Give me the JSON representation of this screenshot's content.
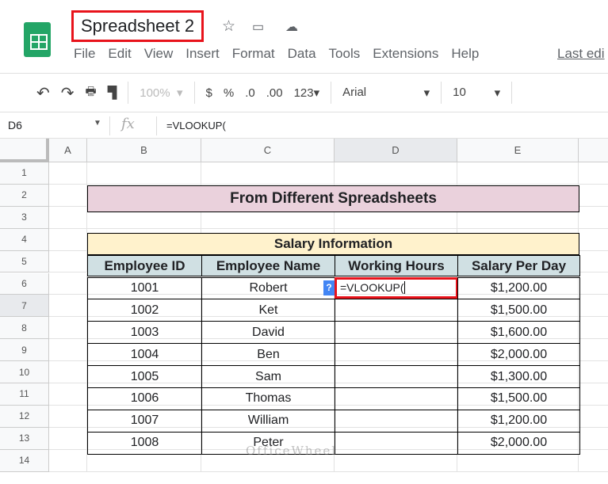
{
  "app": {
    "title": "Spreadsheet 2",
    "menu": [
      "File",
      "Edit",
      "View",
      "Insert",
      "Format",
      "Data",
      "Tools",
      "Extensions",
      "Help"
    ],
    "last_edit": "Last edi"
  },
  "toolbar": {
    "zoom": "100%",
    "currency": "$",
    "percent": "%",
    "dec_decrease": ".0",
    "dec_increase": ".00",
    "more_formats": "123",
    "font": "Arial",
    "font_size": "10"
  },
  "formula_bar": {
    "cell_ref": "D6",
    "fx": "fx",
    "formula": "=VLOOKUP("
  },
  "columns": [
    "A",
    "B",
    "C",
    "D",
    "E"
  ],
  "rows": [
    "1",
    "2",
    "3",
    "4",
    "5",
    "6",
    "7",
    "8",
    "9",
    "10",
    "11",
    "12",
    "13",
    "14"
  ],
  "sheet": {
    "title": "From Different Spreadsheets",
    "table_title": "Salary Information",
    "headers": [
      "Employee ID",
      "Employee Name",
      "Working Hours",
      "Salary Per Day"
    ],
    "data": [
      [
        "1001",
        "Robert",
        "=VLOOKUP(",
        "$1,200.00"
      ],
      [
        "1002",
        "Ket",
        "",
        "$1,500.00"
      ],
      [
        "1003",
        "David",
        "",
        "$1,600.00"
      ],
      [
        "1004",
        "Ben",
        "",
        "$2,000.00"
      ],
      [
        "1005",
        "Sam",
        "",
        "$1,300.00"
      ],
      [
        "1006",
        "Thomas",
        "",
        "$1,500.00"
      ],
      [
        "1007",
        "William",
        "",
        "$1,200.00"
      ],
      [
        "1008",
        "Peter",
        "",
        "$2,000.00"
      ]
    ]
  },
  "help_badge": "?",
  "watermark": "OfficeWheel",
  "colors": {
    "title_fill": "#ead1dc",
    "table_title_fill": "#fff2cc",
    "header_fill": "#d0e0e3",
    "highlight": "#e8131b"
  }
}
